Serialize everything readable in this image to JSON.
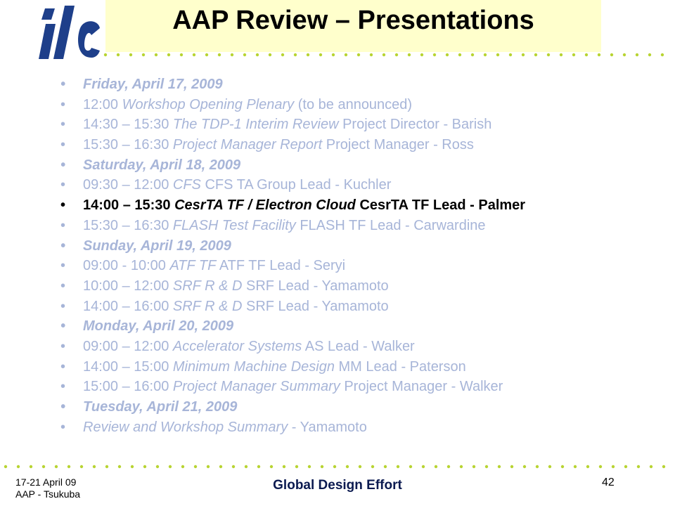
{
  "header": {
    "title": "AAP Review – Presentations"
  },
  "colors": {
    "accent_dots": "#b8d432",
    "title_bg": "#ffffcc",
    "logo_blue": "#1e3f8a",
    "text_muted": "#a7b5d8",
    "text_active": "#000000"
  },
  "icons": {
    "logo": "ilc-logo-icon",
    "bullet": "bullet-icon"
  },
  "schedule": [
    {
      "kind": "day",
      "parts": [
        "Friday, April 17, 2009"
      ]
    },
    {
      "kind": "session",
      "parts": [
        "12:00 ",
        "Workshop Opening Plenary",
        " (to be announced)"
      ]
    },
    {
      "kind": "session",
      "parts": [
        "14:30 – 15:30 ",
        "The TDP-1 Interim Review",
        " Project Director - Barish"
      ]
    },
    {
      "kind": "session",
      "parts": [
        "15:30 – 16:30 ",
        "Project Manager Report",
        " Project Manager - Ross"
      ]
    },
    {
      "kind": "day",
      "parts": [
        "Saturday, April 18, 2009"
      ]
    },
    {
      "kind": "session",
      "parts": [
        "09:30 – 12:00 ",
        "CFS",
        " CFS TA Group Lead - Kuchler"
      ]
    },
    {
      "kind": "active",
      "parts": [
        "14:00 – 15:30 ",
        "CesrTA TF / Electron Cloud",
        " CesrTA TF Lead - Palmer"
      ]
    },
    {
      "kind": "session",
      "parts": [
        "15:30 – 16:30 ",
        "FLASH Test Facility",
        " FLASH TF Lead - Carwardine"
      ]
    },
    {
      "kind": "day",
      "parts": [
        "Sunday, April 19, 2009"
      ]
    },
    {
      "kind": "session",
      "parts": [
        "09:00 - 10:00 ",
        "ATF TF",
        " ATF TF Lead - Seryi"
      ]
    },
    {
      "kind": "session",
      "parts": [
        "10:00 – 12:00 ",
        "SRF R & D",
        " SRF Lead - Yamamoto"
      ]
    },
    {
      "kind": "session",
      "parts": [
        "14:00 – 16:00 ",
        "SRF R & D",
        " SRF Lead - Yamamoto"
      ]
    },
    {
      "kind": "day",
      "parts": [
        "Monday, April 20, 2009"
      ]
    },
    {
      "kind": "session",
      "parts": [
        "09:00 – 12:00 ",
        "Accelerator Systems",
        " AS Lead - Walker"
      ]
    },
    {
      "kind": "session",
      "parts": [
        "14:00 – 15:00 ",
        "Minimum Machine Design",
        " MM Lead - Paterson"
      ]
    },
    {
      "kind": "session",
      "parts": [
        "15:00 – 16:00 ",
        "Project Manager Summary",
        " Project Manager - Walker"
      ]
    },
    {
      "kind": "day",
      "parts": [
        "Tuesday, April 21, 2009"
      ]
    },
    {
      "kind": "session",
      "parts": [
        "",
        "Review and Workshop Summary",
        " - Yamamoto"
      ]
    }
  ],
  "footer": {
    "date_line": "17-21 April 09",
    "venue_line": "AAP - Tsukuba",
    "center": "Global Design Effort",
    "page": "42"
  }
}
